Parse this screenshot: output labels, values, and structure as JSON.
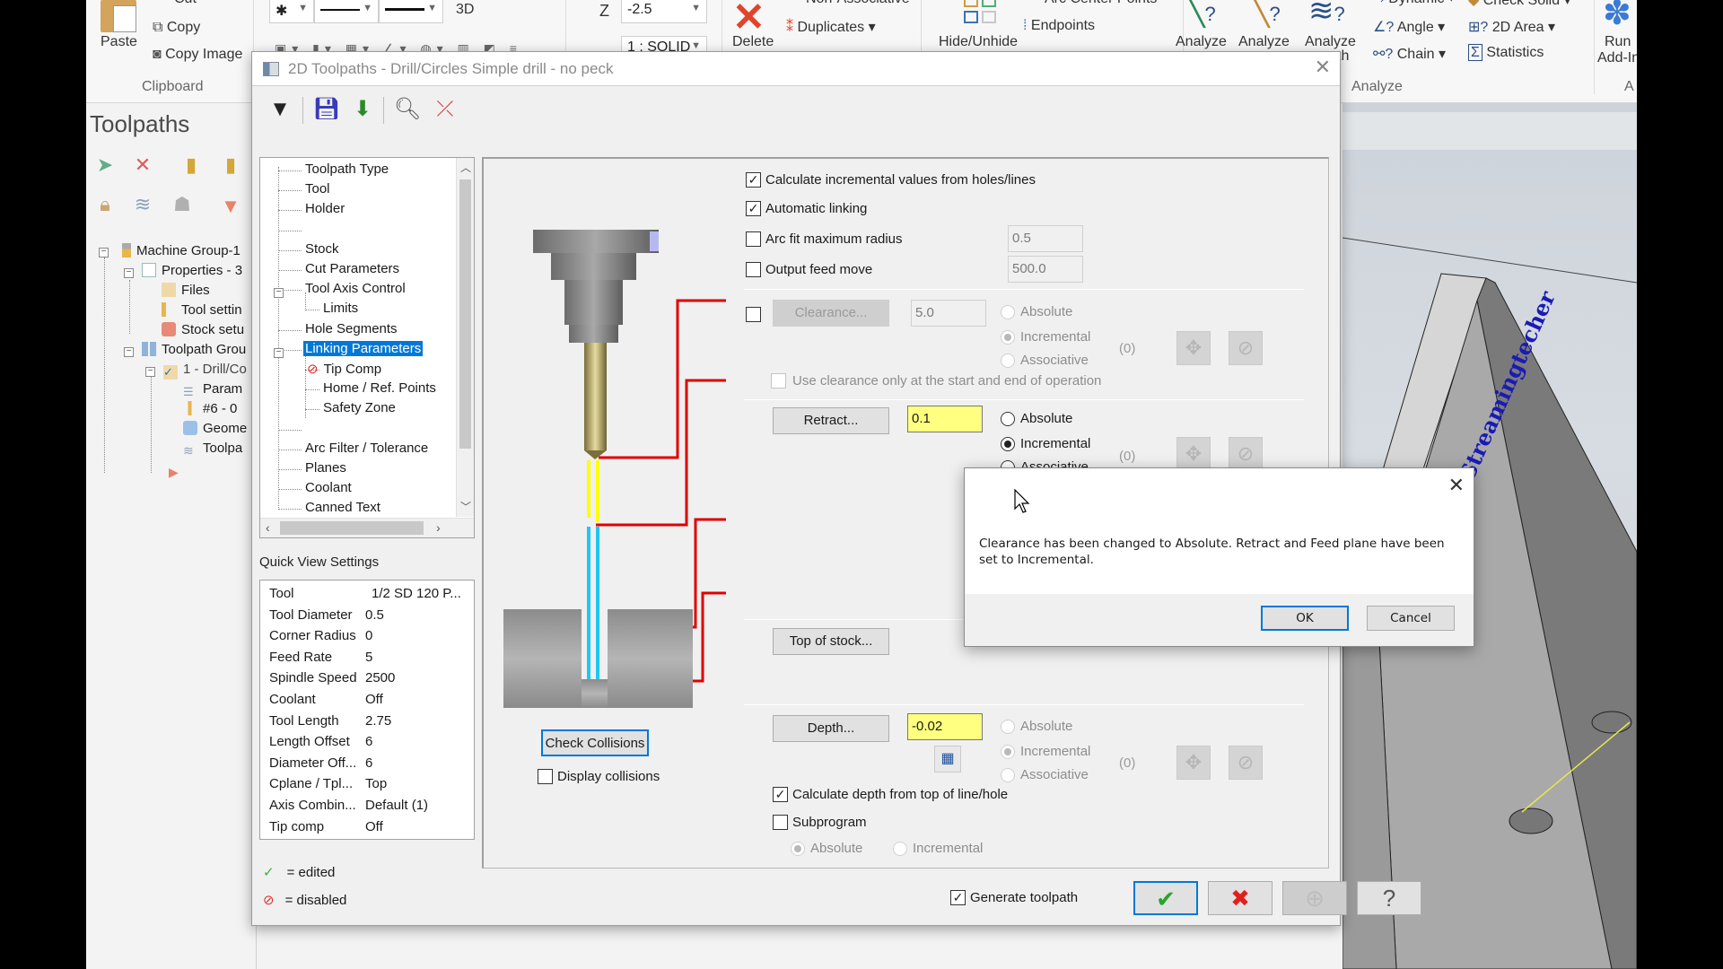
{
  "ribbon": {
    "paste": "Paste",
    "cut": "Cut",
    "copy": "Copy",
    "copy_image": "Copy Image",
    "clipboard_group": "Clipboard",
    "mode_3d": "3D",
    "z_label": "Z",
    "z_value": "-2.5",
    "level_value": "1 : SOLID",
    "delete": "Delete",
    "non_associative": "Non-Associative",
    "duplicates": "Duplicates",
    "hide_unhide": "Hide/Unhide",
    "arc_center_points": "Arc Center Points",
    "endpoints": "Endpoints",
    "analyze1": "Analyze",
    "analyze2": "Analyze",
    "analyze3": "Analyze",
    "analyze3_sub": "th",
    "dynamic": "Dynamic",
    "angle": "Angle",
    "chain": "Chain",
    "check_solid": "Check Solid",
    "area_2d": "2D Area",
    "statistics": "Statistics",
    "analyze_group": "Analyze",
    "run": "Run",
    "add_in": "Add-In",
    "addins_group": "A"
  },
  "manager": {
    "title": "Toolpaths",
    "tree": [
      {
        "label": "Machine Group-1"
      },
      {
        "label": "Properties - 3"
      },
      {
        "label": "Files"
      },
      {
        "label": "Tool settin"
      },
      {
        "label": "Stock setu"
      },
      {
        "label": "Toolpath Grou"
      },
      {
        "label": "1 - Drill/Co"
      },
      {
        "label": "Param"
      },
      {
        "label": "#6 - 0"
      },
      {
        "label": "Geome"
      },
      {
        "label": "Toolpa"
      }
    ]
  },
  "dialog": {
    "title": "2D Toolpaths - Drill/Circles Simple drill - no peck",
    "param_tree": [
      {
        "label": "Toolpath Type"
      },
      {
        "label": "Tool"
      },
      {
        "label": "Holder"
      },
      {
        "label": ""
      },
      {
        "label": "Stock"
      },
      {
        "label": "Cut Parameters"
      },
      {
        "label": "Tool Axis Control"
      },
      {
        "label": "Limits"
      },
      {
        "label": "Hole Segments"
      },
      {
        "label": "Linking Parameters"
      },
      {
        "label": "Tip Comp"
      },
      {
        "label": "Home / Ref. Points"
      },
      {
        "label": "Safety Zone"
      },
      {
        "label": ""
      },
      {
        "label": "Arc Filter / Tolerance"
      },
      {
        "label": "Planes"
      },
      {
        "label": "Coolant"
      },
      {
        "label": "Canned Text"
      }
    ],
    "quick_view_label": "Quick View Settings",
    "quick_view": [
      {
        "key": "Tool",
        "value": "1/2 SD 120 P..."
      },
      {
        "key": "Tool Diameter",
        "value": "0.5"
      },
      {
        "key": "Corner Radius",
        "value": "0"
      },
      {
        "key": "Feed Rate",
        "value": "5"
      },
      {
        "key": "Spindle Speed",
        "value": "2500"
      },
      {
        "key": "Coolant",
        "value": "Off"
      },
      {
        "key": "Tool Length",
        "value": "2.75"
      },
      {
        "key": "Length Offset",
        "value": "6"
      },
      {
        "key": "Diameter Off...",
        "value": "6"
      },
      {
        "key": "Cplane / Tpl...",
        "value": "Top"
      },
      {
        "key": "Axis Combin...",
        "value": "Default (1)"
      },
      {
        "key": "Tip comp",
        "value": "Off"
      }
    ],
    "legend_edited": "= edited",
    "legend_disabled": "= disabled",
    "check_collisions": "Check Collisions",
    "display_collisions": "Display collisions",
    "calc_incremental": "Calculate incremental values from holes/lines",
    "automatic_linking": "Automatic linking",
    "arc_fit": "Arc fit maximum radius",
    "arc_fit_value": "0.5",
    "output_feed": "Output feed move",
    "output_feed_value": "500.0",
    "clearance_btn": "Clearance...",
    "clearance_value": "5.0",
    "use_clearance": "Use clearance only at the start and end of operation",
    "retract_btn": "Retract...",
    "retract_value": "0.1",
    "top_of_stock_btn": "Top of stock...",
    "depth_btn": "Depth...",
    "depth_value": "-0.02",
    "absolute": "Absolute",
    "incremental": "Incremental",
    "associative": "Associative",
    "zero_count": "(0)",
    "calc_depth": "Calculate depth from top of line/hole",
    "subprogram": "Subprogram",
    "generate_toolpath": "Generate toolpath"
  },
  "message_box": {
    "text": "Clearance has been changed to Absolute. Retract and Feed plane have been set to Incremental.",
    "ok": "OK",
    "cancel": "Cancel"
  },
  "viewport": {
    "part_text": "Streamingtecher"
  },
  "colors": {
    "selection": "#0078d7",
    "highlight_field": "#ffff80",
    "diagram_red": "#e00000",
    "diagram_yellow": "#ffff00",
    "diagram_cyan": "#1ec8f0"
  }
}
